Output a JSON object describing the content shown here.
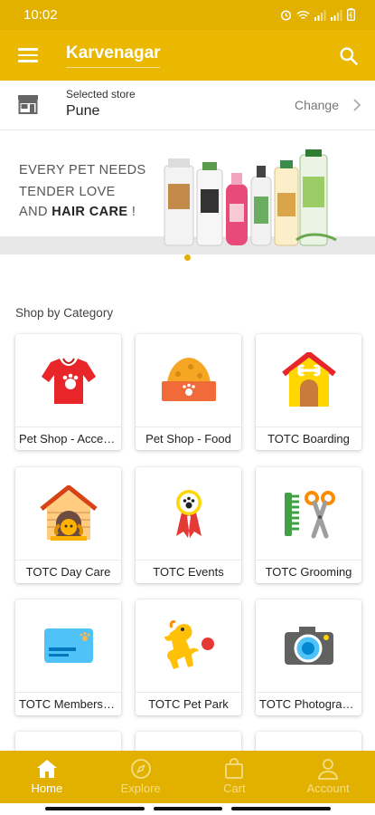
{
  "status_bar": {
    "time": "10:02"
  },
  "app_bar": {
    "location": "Karvenagar"
  },
  "store": {
    "caption": "Selected store",
    "name": "Pune",
    "change_label": "Change"
  },
  "banner": {
    "line1": "EVERY PET NEEDS",
    "line2": "TENDER LOVE",
    "line3_prefix": "AND ",
    "line3_bold": "HAIR CARE",
    "line3_suffix": " !"
  },
  "section_title": "Shop by Category",
  "categories": [
    {
      "label": "Pet Shop - Accessories",
      "icon": "shirt-icon"
    },
    {
      "label": "Pet Shop - Food",
      "icon": "food-bowl-icon"
    },
    {
      "label": "TOTC Boarding",
      "icon": "doghouse-icon"
    },
    {
      "label": "TOTC Day Care",
      "icon": "dog-in-house-icon"
    },
    {
      "label": "TOTC Events",
      "icon": "award-ribbon-icon"
    },
    {
      "label": "TOTC Grooming",
      "icon": "comb-scissors-icon"
    },
    {
      "label": "TOTC Membership",
      "icon": "membership-card-icon"
    },
    {
      "label": "TOTC Pet Park",
      "icon": "dog-playing-ball-icon"
    },
    {
      "label": "TOTC Photography",
      "icon": "camera-icon"
    }
  ],
  "bottom_nav": [
    {
      "label": "Home",
      "icon": "home-icon",
      "active": true
    },
    {
      "label": "Explore",
      "icon": "compass-icon",
      "active": false
    },
    {
      "label": "Cart",
      "icon": "shopping-bag-icon",
      "active": false
    },
    {
      "label": "Account",
      "icon": "person-icon",
      "active": false
    }
  ],
  "colors": {
    "primary": "#eab800",
    "status_bar": "#e2b100",
    "accent_red": "#e53935"
  }
}
